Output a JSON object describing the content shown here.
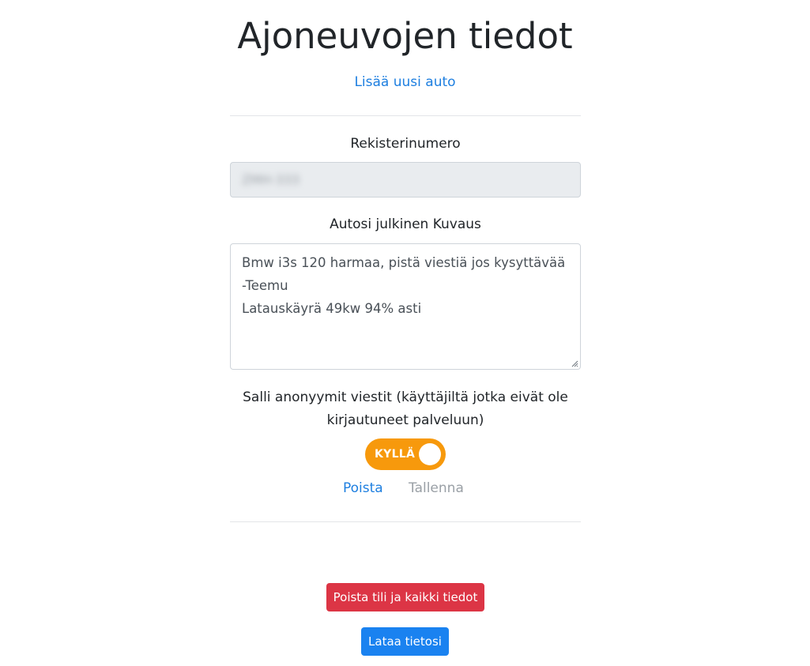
{
  "page": {
    "title": "Ajoneuvojen tiedot",
    "add_car_link": "Lisää uusi auto"
  },
  "vehicle": {
    "plate_label": "Rekisterinumero",
    "plate_value": "ZMH-333",
    "description_label": "Autosi julkinen Kuvaus",
    "description_value": "Bmw i3s 120 harmaa, pistä viestiä jos kysyttävää\n-Teemu\nLatauskäyrä 49kw 94% asti",
    "anonymous_label": "Salli anonyymit viestit (käyttäjiltä jotka eivät ole kirjautuneet palveluun)",
    "toggle_label": "KYLLÄ",
    "toggle_on": true,
    "delete_link": "Poista",
    "save_link": "Tallenna"
  },
  "account": {
    "delete_account_button": "Poista tili ja kaikki tiedot",
    "download_data_button": "Lataa tietosi"
  },
  "colors": {
    "link": "#1e7fe0",
    "toggle_on": "#f7990c",
    "danger": "#dc3545",
    "primary": "#1a82f0",
    "disabled_text": "#9aa0a6"
  }
}
